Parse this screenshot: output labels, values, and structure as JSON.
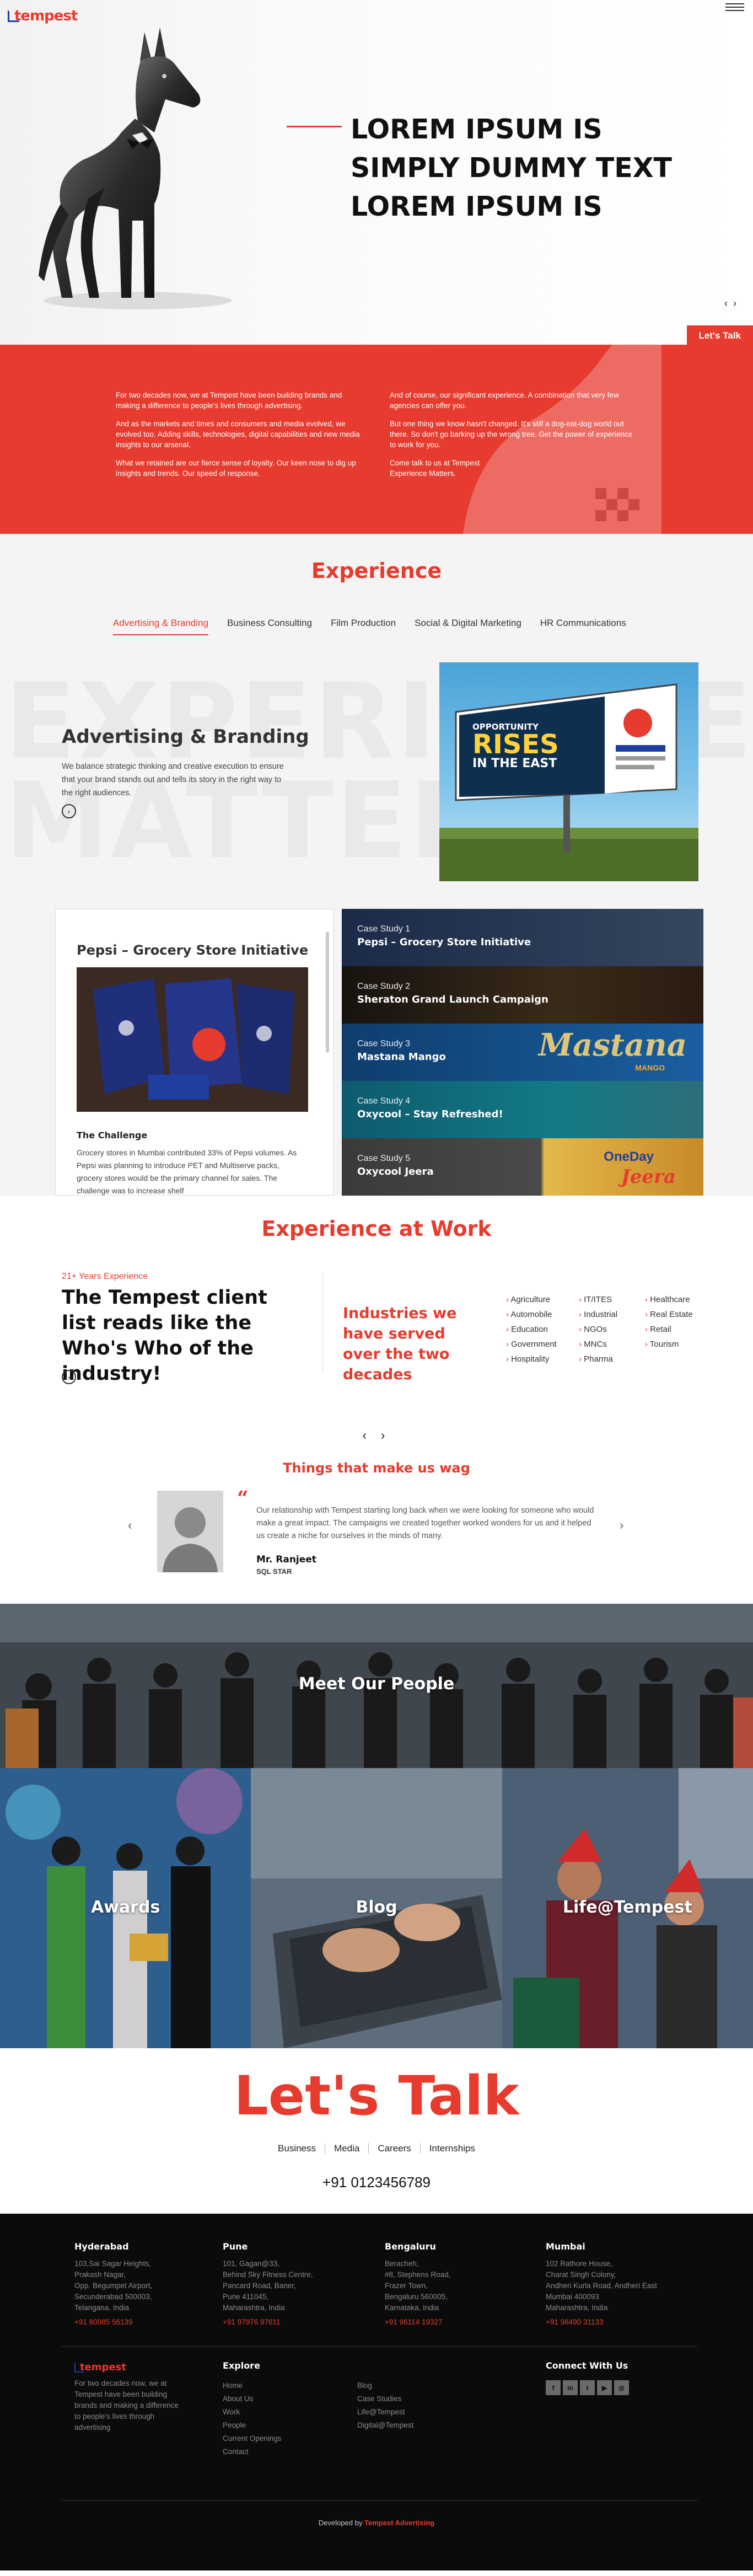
{
  "brand": {
    "logo_text": "tempest"
  },
  "hero": {
    "title": "LOREM IPSUM IS SIMPLY DUMMY TEXT LOREM IPSUM IS",
    "prev": "‹",
    "next": "›",
    "cta": "Let's Talk"
  },
  "about": {
    "left": [
      "For two decades now, we at Tempest have been building brands and making a difference to people's lives through advertising.",
      "And as the markets and times and consumers and media evolved, we evolved too. Adding skills, technologies, digital capabilities and new media insights to our arsenal.",
      "What we retained are our fierce sense of loyalty. Our keen nose to dig up insights and trends. Our speed of response."
    ],
    "right": [
      "And of course, our significant experience. A combination that very few agencies can offer you.",
      "But one thing we know hasn't changed. It's still a dog-eat-dog world out there. So don't go barking up the wrong tree. Get the power of experience to work for you.",
      "Come talk to us at Tempest\nExperience Matters."
    ]
  },
  "experience": {
    "title": "Experience",
    "tabs": [
      "Advertising & Branding",
      "Business Consulting",
      "Film Production",
      "Social & Digital Marketing",
      "HR Communications"
    ],
    "bg_words": [
      "EXPERIENCE",
      "MATTERS"
    ],
    "heading": "Advertising & Branding",
    "text": "We balance strategic thinking and creative execution to ensure that your brand stands out and tells its story in the right way to the right audiences.",
    "billboard": {
      "line1": "OPPORTUNITY",
      "line2": "RISES",
      "line3": "IN THE EAST"
    },
    "case_detail": {
      "title": "Pepsi – Grocery Store Initiative",
      "challenge_label": "The Challenge",
      "challenge_text": "Grocery stores in Mumbai contributed 33% of Pepsi volumes. As Pepsi was planning to introduce PET and Multiserve packs, grocery stores would be the primary channel for sales. The challenge was to increase shelf"
    },
    "case_studies": [
      {
        "num": "Case Study 1",
        "name": "Pepsi – Grocery Store Initiative"
      },
      {
        "num": "Case Study 2",
        "name": "Sheraton Grand Launch Campaign"
      },
      {
        "num": "Case Study 3",
        "name": "Mastana Mango"
      },
      {
        "num": "Case Study 4",
        "name": "Oxycool – Stay Refreshed!"
      },
      {
        "num": "Case Study 5",
        "name": "Oxycool Jeera"
      }
    ],
    "case_art": {
      "mastana": "Mastana",
      "mango": "MANGO",
      "oneday": "OneDay",
      "jeera": "Jeera"
    }
  },
  "at_work": {
    "title": "Experience at Work",
    "years": "21+ Years Experience",
    "headline": "The Tempest client list reads like the Who's Who of the industry!",
    "industries_title": "Industries we have served over the two decades",
    "industries": [
      "Agriculture",
      "IT/ITES",
      "Healthcare",
      "Automobile",
      "Industrial",
      "Real Estate",
      "Education",
      "NGOs",
      "Retail",
      "Government",
      "MNCs",
      "Tourism",
      "Hospitality",
      "Pharma",
      ""
    ],
    "nav": "‹ ›"
  },
  "testimonial": {
    "title": "Things that make us wag",
    "prev": "‹",
    "next": "›",
    "quote_mark": "“",
    "text": "Our relationship with Tempest starting long back when we were looking for someone who would make a great impact. The campaigns we created together worked wonders for us and it helped us create a niche for ourselves in the minds of many.",
    "name": "Mr. Ranjeet",
    "role": "SQL STAR"
  },
  "tiles": {
    "people": "Meet Our People",
    "awards": "Awards",
    "blog": "Blog",
    "life": "Life@Tempest"
  },
  "talk": {
    "title": "Let's Talk",
    "links": [
      "Business",
      "Media",
      "Careers",
      "Internships"
    ],
    "phone": "+91 0123456789"
  },
  "footer": {
    "cities": [
      {
        "name": "Hyderabad",
        "addr": "103,Sai Sagar Heights,\nPrakash Nagar,\nOpp. Begumpet Airport,\nSecunderabad 500003,\nTelangana, India",
        "phone": "+91 80085 56139"
      },
      {
        "name": "Pune",
        "addr": "101, Gagan@33,\nBehind Sky Fitness Centre,\nPancard Road, Baner,\nPune 411045,\nMaharashtra, India",
        "phone": "+91 97976 97611"
      },
      {
        "name": "Bengaluru",
        "addr": "Beracheh,\n#8, Stephens Road,\nFrazer Town,\nBengaluru 560005,\nKarnataka, India",
        "phone": "+91 96114 19327"
      },
      {
        "name": "Mumbai",
        "addr": "102 Rathore House,\nCharat Singh Colony,\nAndheri Kurla Road, Andheri East\nMumbai 400093\nMaharashtra, India",
        "phone": "+91 98490 31133"
      }
    ],
    "logo_text": "tempest",
    "tagline": "For two decades now, we at Tempest have been building brands and making a difference to people's lives through advertising",
    "explore_title": "Explore",
    "explore_col1": [
      "Home",
      "About Us",
      "Work",
      "People",
      "Current Openings",
      "Contact"
    ],
    "explore_col2": [
      "Blog",
      "Case Studies",
      "Life@Tempest",
      "Digital@Tempest"
    ],
    "connect_title": "Connect With Us",
    "socials": [
      "f",
      "in",
      "t",
      "▶",
      "◎"
    ],
    "dev_prefix": "Developed by",
    "dev_name": "Tempest Advertising"
  },
  "colors": {
    "accent": "#e63b2e",
    "logo_blue": "#1f3fa0",
    "footer_bg": "#0b0b0b"
  }
}
